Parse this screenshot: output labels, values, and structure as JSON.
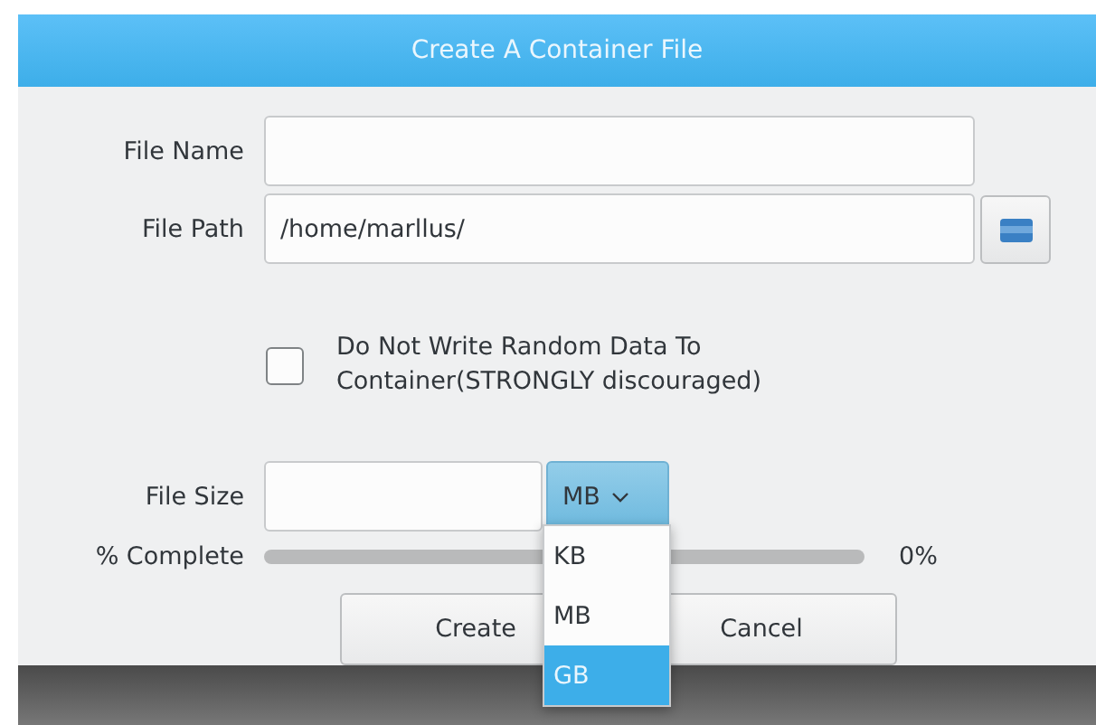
{
  "window": {
    "title": "Create A Container File"
  },
  "file_name": {
    "label": "File Name"
  },
  "file_path": {
    "label": "File Path",
    "value": "/home/marllus/"
  },
  "no_random": {
    "label": "Do Not Write Random Data To Container(STRONGLY discouraged)",
    "checked": false
  },
  "file_size": {
    "label": "File Size",
    "unit": "MB",
    "expanded": true,
    "options": [
      {
        "label": "KB",
        "selected": false
      },
      {
        "label": "MB",
        "selected": false
      },
      {
        "label": "GB",
        "selected": true
      }
    ]
  },
  "progress": {
    "label": "% Complete",
    "level": 0,
    "reading": "0%"
  },
  "buttons": [
    "Create",
    "Cancel"
  ]
}
